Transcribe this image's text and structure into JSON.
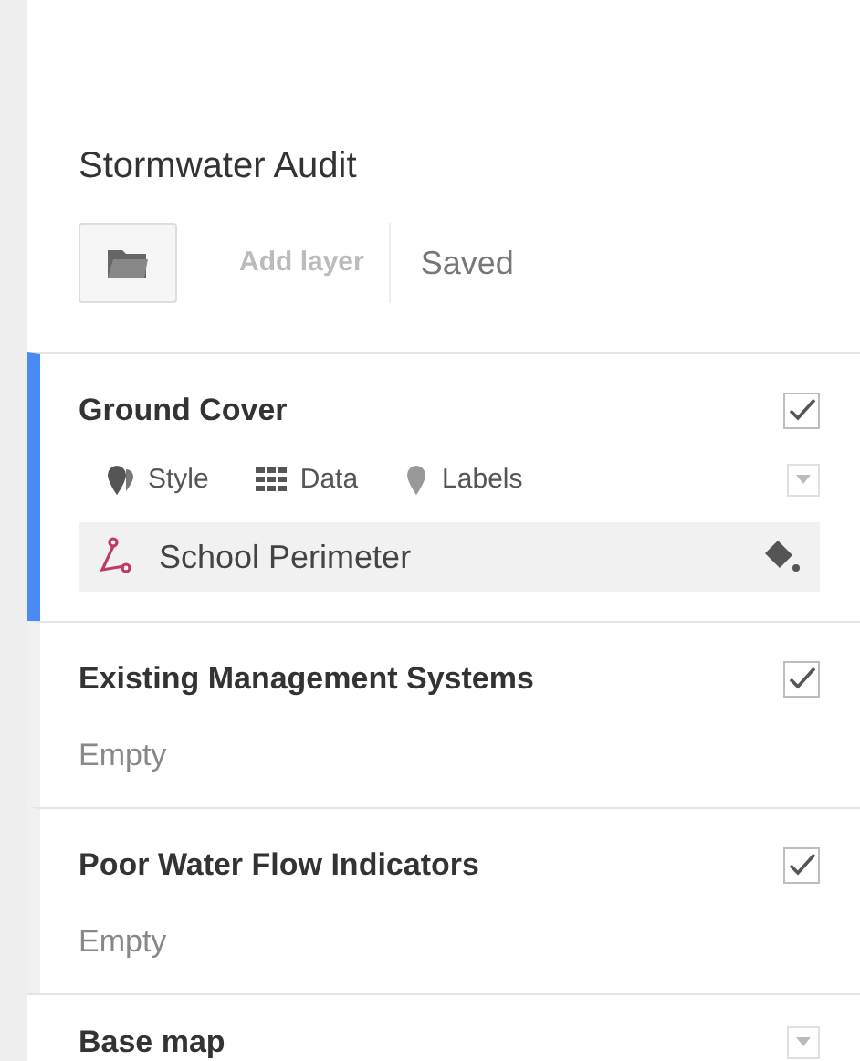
{
  "title": "Stormwater Audit",
  "toolbar": {
    "add_layer": "Add layer",
    "status": "Saved"
  },
  "layers": [
    {
      "kind": "layer",
      "name": "Ground Cover",
      "selected": true,
      "checked": true,
      "tools": [
        "Style",
        "Data",
        "Labels"
      ],
      "features": [
        {
          "name": "School Perimeter"
        }
      ]
    },
    {
      "kind": "layer",
      "name": "Existing Management Systems",
      "selected": false,
      "checked": true,
      "empty_text": "Empty"
    },
    {
      "kind": "layer",
      "name": "Poor Water Flow Indicators",
      "selected": false,
      "checked": true,
      "empty_text": "Empty"
    },
    {
      "kind": "basemap",
      "name": "Base map"
    }
  ]
}
